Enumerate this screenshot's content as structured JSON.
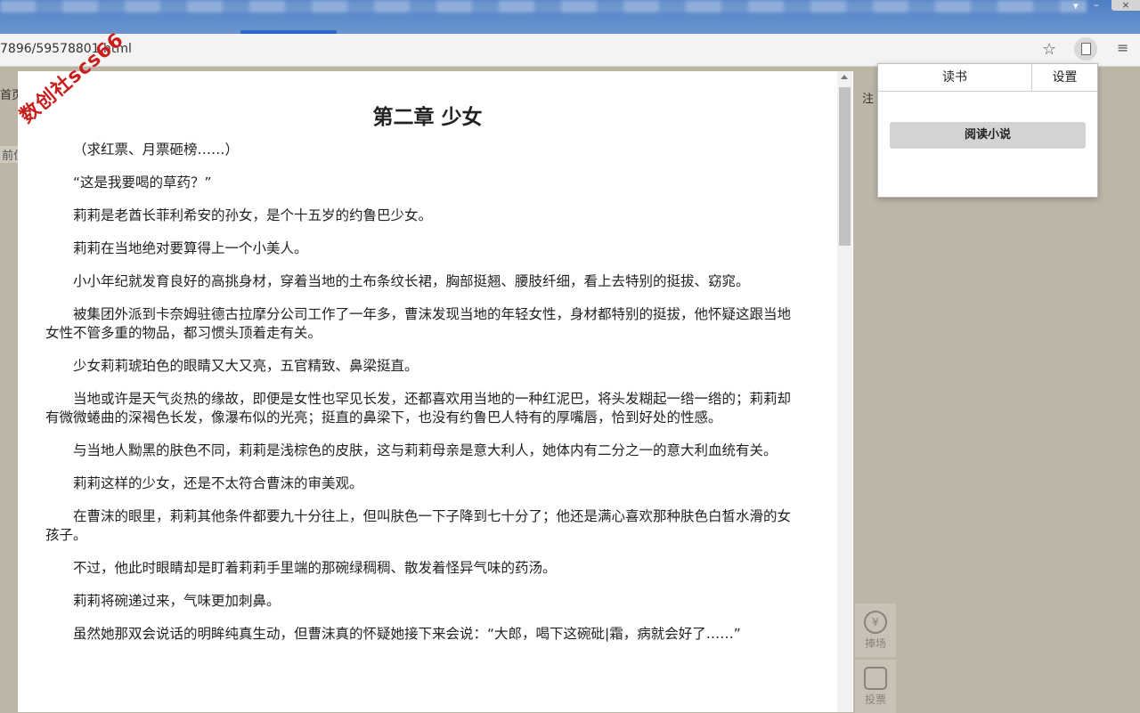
{
  "browser": {
    "url": "7896/59578801.html",
    "window_controls": {
      "minimize": "–",
      "close": "×"
    },
    "icons": [
      "star-icon",
      "extension-book-icon",
      "reading-list-icon"
    ]
  },
  "site": {
    "nav_fragment": "首页",
    "position_fragment": "前位",
    "right_fragment": "注",
    "watermark": "数创社scs66",
    "float_buttons": {
      "rank": "捧场",
      "vote": "投票",
      "rank_glyph": "¥"
    }
  },
  "reader": {
    "chapter_title": "第二章 少女",
    "paragraphs": [
      "（求红票、月票砸榜……）",
      "“这是我要喝的草药？”",
      "莉莉是老酋长菲利希安的孙女，是个十五岁的约鲁巴少女。",
      "莉莉在当地绝对要算得上一个小美人。",
      "小小年纪就发育良好的高挑身材，穿着当地的土布条纹长裙，胸部挺翘、腰肢纤细，看上去特别的挺拔、窈窕。",
      "被集团外派到卡奈姆驻德古拉摩分公司工作了一年多，曹沫发现当地的年轻女性，身材都特别的挺拔，他怀疑这跟当地女性不管多重的物品，都习惯头顶着走有关。",
      "少女莉莉琥珀色的眼睛又大又亮，五官精致、鼻梁挺直。",
      "当地或许是天气炎热的缘故，即便是女性也罕见长发，还都喜欢用当地的一种红泥巴，将头发糊起一绺一绺的；莉莉却有微微蜷曲的深褐色长发，像瀑布似的光亮；挺直的鼻梁下，也没有约鲁巴人特有的厚嘴唇，恰到好处的性感。",
      "与当地人黝黑的肤色不同，莉莉是浅棕色的皮肤，这与莉莉母亲是意大利人，她体内有二分之一的意大利血统有关。",
      "莉莉这样的少女，还是不太符合曹沫的审美观。",
      "在曹沫的眼里，莉莉其他条件都要九十分往上，但叫肤色一下子降到七十分了；他还是满心喜欢那种肤色白皙水滑的女孩子。",
      "不过，他此时眼睛却是盯着莉莉手里端的那碗绿稠稠、散发着怪异气味的药汤。",
      "莉莉将碗递过来，气味更加刺鼻。",
      "虽然她那双会说话的明眸纯真生动，但曹沫真的怀疑她接下来会说：“大郎，喝下这碗砒|霜，病就会好了……”"
    ]
  },
  "popup": {
    "tabs": [
      "读书",
      "设置"
    ],
    "active_tab": "读书",
    "read_novel_button": "阅读小说"
  }
}
